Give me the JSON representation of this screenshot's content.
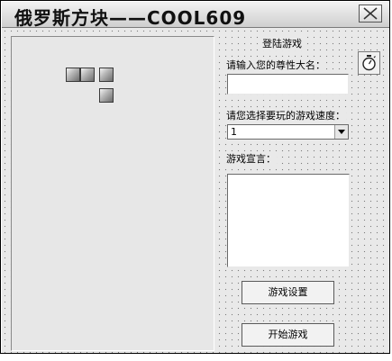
{
  "window": {
    "title": "俄罗斯方块——COOL609"
  },
  "icons": {
    "close": "close-icon",
    "timer": "stopwatch-icon"
  },
  "panel": {
    "heading": "登陆游戏",
    "name_label": "请输入您的尊性大名：",
    "name_value": "",
    "speed_label": "请您选择要玩的游戏速度：",
    "speed_value": "1",
    "slogan_label": "游戏宣言：",
    "slogan_value": "",
    "settings_button": "游戏设置",
    "start_button": "开始游戏"
  }
}
